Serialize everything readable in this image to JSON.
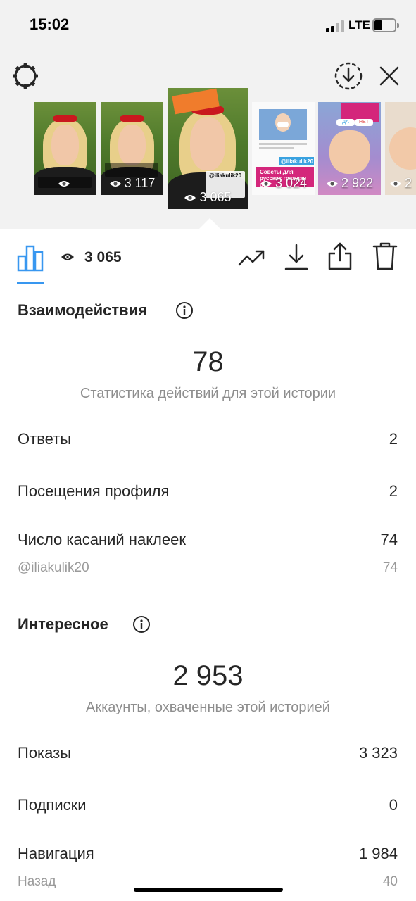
{
  "status_bar": {
    "time": "15:02",
    "network": "LTE",
    "battery_level": 0.3
  },
  "top_bar": {
    "left_icon": "gear-icon",
    "right_icons": [
      "download-circle-icon",
      "close-icon"
    ]
  },
  "thumbnails": [
    {
      "views": "",
      "overlay_text": "",
      "selected": false
    },
    {
      "views": "3 117",
      "overlay_text": "",
      "selected": false
    },
    {
      "views": "3 065",
      "overlay_text": "@iliakulik20",
      "selected": true
    },
    {
      "views": "3 024",
      "overlay_text": "@iliakulik20",
      "subtext": "Советы для русских граждан от",
      "selected": false
    },
    {
      "views": "2 922",
      "overlay_text": "",
      "poll_yes": "ДА",
      "poll_no": "НЕТ",
      "selected": false
    },
    {
      "views": "2",
      "overlay_text": "",
      "selected": false
    }
  ],
  "toolbar": {
    "views_count": "3 065",
    "icons": [
      "bar-chart-icon",
      "eye-icon",
      "trending-icon",
      "download-icon",
      "share-icon",
      "trash-icon"
    ]
  },
  "interactions": {
    "title": "Взаимодействия",
    "total": "78",
    "caption": "Статистика действий для этой истории",
    "rows": [
      {
        "label": "Ответы",
        "value": "2"
      },
      {
        "label": "Посещения профиля",
        "value": "2"
      },
      {
        "label": "Число касаний наклеек",
        "value": "74"
      }
    ],
    "sub_rows": [
      {
        "label": "@iliakulik20",
        "value": "74"
      }
    ]
  },
  "discovery": {
    "title": "Интересное",
    "total": "2 953",
    "caption": "Аккаунты, охваченные этой историей",
    "rows": [
      {
        "label": "Показы",
        "value": "3 323"
      },
      {
        "label": "Подписки",
        "value": "0"
      },
      {
        "label": "Навигация",
        "value": "1 984"
      }
    ],
    "sub_rows": [
      {
        "label": "Назад",
        "value": "40"
      }
    ]
  },
  "colors": {
    "accent": "#3897f0",
    "text": "#262626",
    "muted": "#8e8e8e"
  }
}
